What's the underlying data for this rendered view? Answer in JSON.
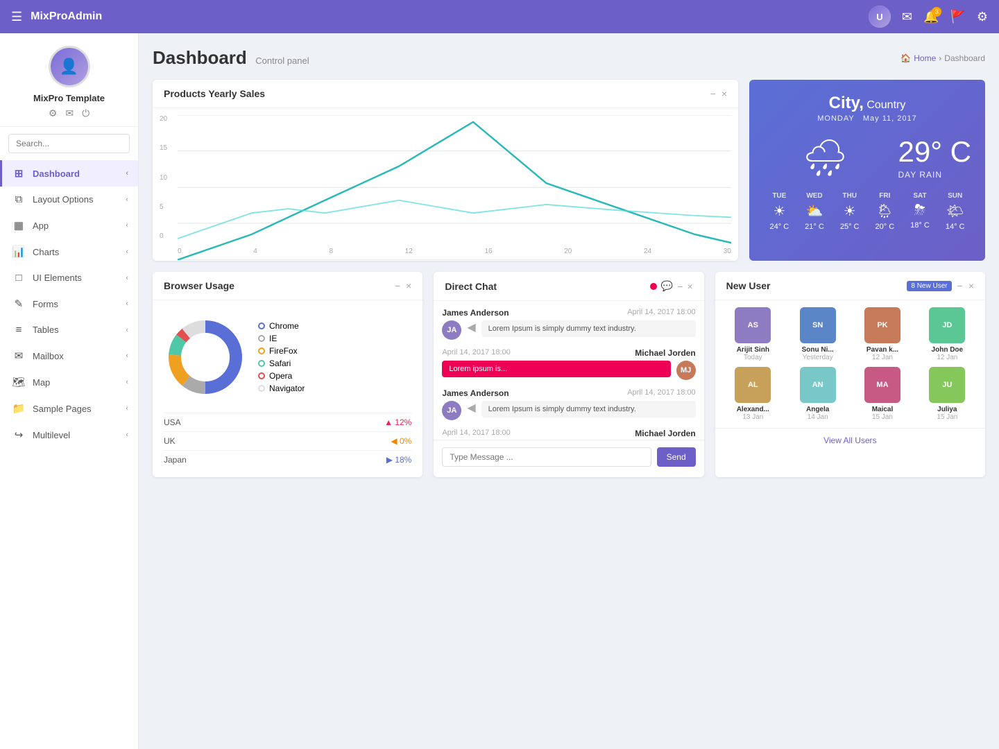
{
  "brand": "MixProAdmin",
  "topnav": {
    "hamburger": "☰",
    "avatar_text": "U",
    "mail_badge": "",
    "bell_badge": "3",
    "flag_badge": "",
    "gear_label": "⚙"
  },
  "sidebar": {
    "user_name": "MixPro Template",
    "search_placeholder": "Search...",
    "nav_items": [
      {
        "icon": "⊞",
        "label": "Dashboard",
        "active": true
      },
      {
        "icon": "⧉",
        "label": "Layout Options",
        "active": false
      },
      {
        "icon": "▦",
        "label": "App",
        "active": false
      },
      {
        "icon": "📊",
        "label": "Charts",
        "active": false
      },
      {
        "icon": "□",
        "label": "UI Elements",
        "active": false
      },
      {
        "icon": "✎",
        "label": "Forms",
        "active": false
      },
      {
        "icon": "≡",
        "label": "Tables",
        "active": false
      },
      {
        "icon": "✉",
        "label": "Mailbox",
        "active": false
      },
      {
        "icon": "🗺",
        "label": "Map",
        "active": false
      },
      {
        "icon": "📁",
        "label": "Sample Pages",
        "active": false
      },
      {
        "icon": "↪",
        "label": "Multilevel",
        "active": false
      }
    ]
  },
  "page": {
    "title": "Dashboard",
    "subtitle": "Control panel",
    "breadcrumb_home": "Home",
    "breadcrumb_current": "Dashboard"
  },
  "products_chart": {
    "title": "Products Yearly Sales",
    "y_labels": [
      "20",
      "15",
      "10",
      "5",
      "0"
    ],
    "x_labels": [
      "0",
      "4",
      "8",
      "12",
      "16",
      "20",
      "24",
      "30"
    ]
  },
  "weather": {
    "city": "City,",
    "country": "Country",
    "day": "MONDAY",
    "date": "May 11, 2017",
    "temp": "29°",
    "unit": "C",
    "description": "DAY RAIN",
    "forecast": [
      {
        "day": "TUE",
        "icon": "☀",
        "temp": "24ᵒ C"
      },
      {
        "day": "WED",
        "icon": "⛅",
        "temp": "21ᵒ C"
      },
      {
        "day": "THU",
        "icon": "☀",
        "temp": "25ᵒ C"
      },
      {
        "day": "FRI",
        "icon": "🌦",
        "temp": "20ᵒ C"
      },
      {
        "day": "SAT",
        "icon": "⛈",
        "temp": "18ᵒ C"
      },
      {
        "day": "SUN",
        "icon": "🌤",
        "temp": "14ᵒ C"
      }
    ]
  },
  "browser_usage": {
    "title": "Browser Usage",
    "legend": [
      {
        "name": "Chrome",
        "color": "#5a6fd6",
        "border": "2px solid #5a6fd6"
      },
      {
        "name": "IE",
        "color": "#aaa",
        "border": "2px solid #aaa"
      },
      {
        "name": "FireFox",
        "color": "#f0a020",
        "border": "2px solid #f0a020"
      },
      {
        "name": "Safari",
        "color": "#50c8a8",
        "border": "2px solid #50c8a8"
      },
      {
        "name": "Opera",
        "color": "#e05050",
        "border": "2px solid #e05050"
      },
      {
        "name": "Navigator",
        "color": "#ddd",
        "border": "2px solid #ddd"
      }
    ],
    "table": [
      {
        "country": "USA",
        "value": "12%",
        "type": "up"
      },
      {
        "country": "UK",
        "value": "0%",
        "type": "down"
      },
      {
        "country": "Japan",
        "value": "18%",
        "type": "blue"
      }
    ]
  },
  "chat": {
    "title": "Direct Chat",
    "messages": [
      {
        "name": "James Anderson",
        "time": "April 14, 2017 18:00",
        "text": "Lorem Ipsum is simply dummy text industry.",
        "side": "left"
      },
      {
        "name": "Michael Jorden",
        "time": "April 14, 2017 18:00",
        "text": "Lorem ipsum is...",
        "side": "right"
      },
      {
        "name": "James Anderson",
        "time": "April 14, 2017 18:00",
        "text": "Lorem Ipsum is simply dummy text industry.",
        "side": "left"
      },
      {
        "name": "Michael Jorden",
        "time": "April 14, 2017 18:00",
        "text": "",
        "side": "right"
      }
    ],
    "input_placeholder": "Type Message ...",
    "send_label": "Send"
  },
  "new_users": {
    "title": "New User",
    "badge": "8 New User",
    "users": [
      {
        "name": "Arijit Sinh",
        "date": "Today",
        "color": "av1"
      },
      {
        "name": "Sonu Ni...",
        "date": "Yesterday",
        "color": "av2"
      },
      {
        "name": "Pavan k...",
        "date": "12 Jan",
        "color": "av3"
      },
      {
        "name": "John Doe",
        "date": "12 Jan",
        "color": "av4"
      },
      {
        "name": "Alexand...",
        "date": "13 Jan",
        "color": "av5"
      },
      {
        "name": "Angela",
        "date": "14 Jan",
        "color": "av6"
      },
      {
        "name": "Maical",
        "date": "15 Jan",
        "color": "av7"
      },
      {
        "name": "Juliya",
        "date": "15 Jan",
        "color": "av8"
      }
    ],
    "view_all_label": "View All Users"
  }
}
